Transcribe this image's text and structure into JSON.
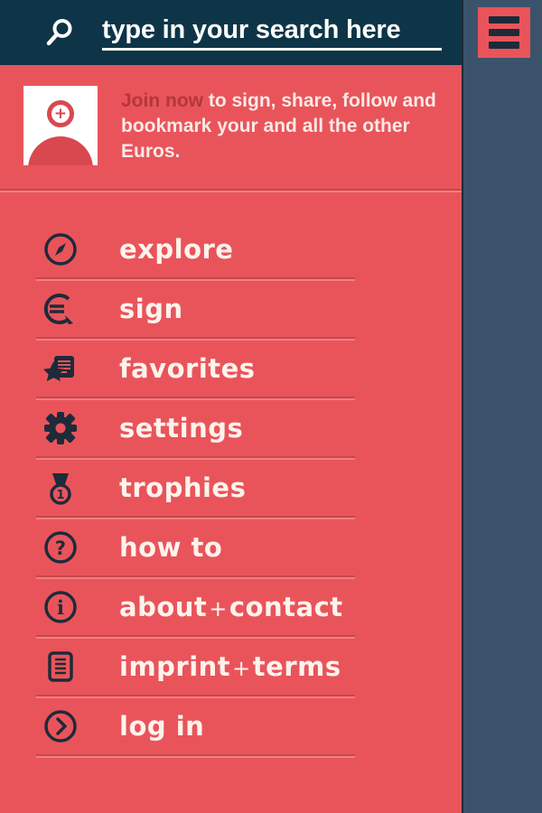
{
  "colors": {
    "panel_red": "#e9545b",
    "header_navy": "#0e3547",
    "page_slate": "#3a536b",
    "icon_dark": "#1d2b3a",
    "label_cream": "#fdf3ec",
    "accent_dark_red": "#b5363d"
  },
  "header": {
    "search_placeholder": "type in your search here",
    "search_value": "",
    "search_icon": "search-icon",
    "menu_button_icon": "hamburger-icon"
  },
  "promo": {
    "avatar_icon": "add-user-avatar-icon",
    "accent_text": "Join now",
    "body_text": " to sign, share, follow and bookmark your and all the other Euros."
  },
  "menu": {
    "items": [
      {
        "label": "explore",
        "icon": "compass-icon"
      },
      {
        "label": "sign",
        "icon": "euro-pen-icon"
      },
      {
        "label": "favorites",
        "icon": "document-star-icon"
      },
      {
        "label": "settings",
        "icon": "gear-icon"
      },
      {
        "label": "trophies",
        "icon": "medal-icon",
        "badge": "1"
      },
      {
        "label": "how to",
        "icon": "question-circle-icon"
      },
      {
        "label": "about",
        "separator": "+",
        "label2": "contact",
        "icon": "info-circle-icon"
      },
      {
        "label": "imprint",
        "separator": "+",
        "label2": "terms",
        "icon": "list-document-icon"
      },
      {
        "label": "log in",
        "icon": "chevron-right-circle-icon"
      }
    ]
  }
}
